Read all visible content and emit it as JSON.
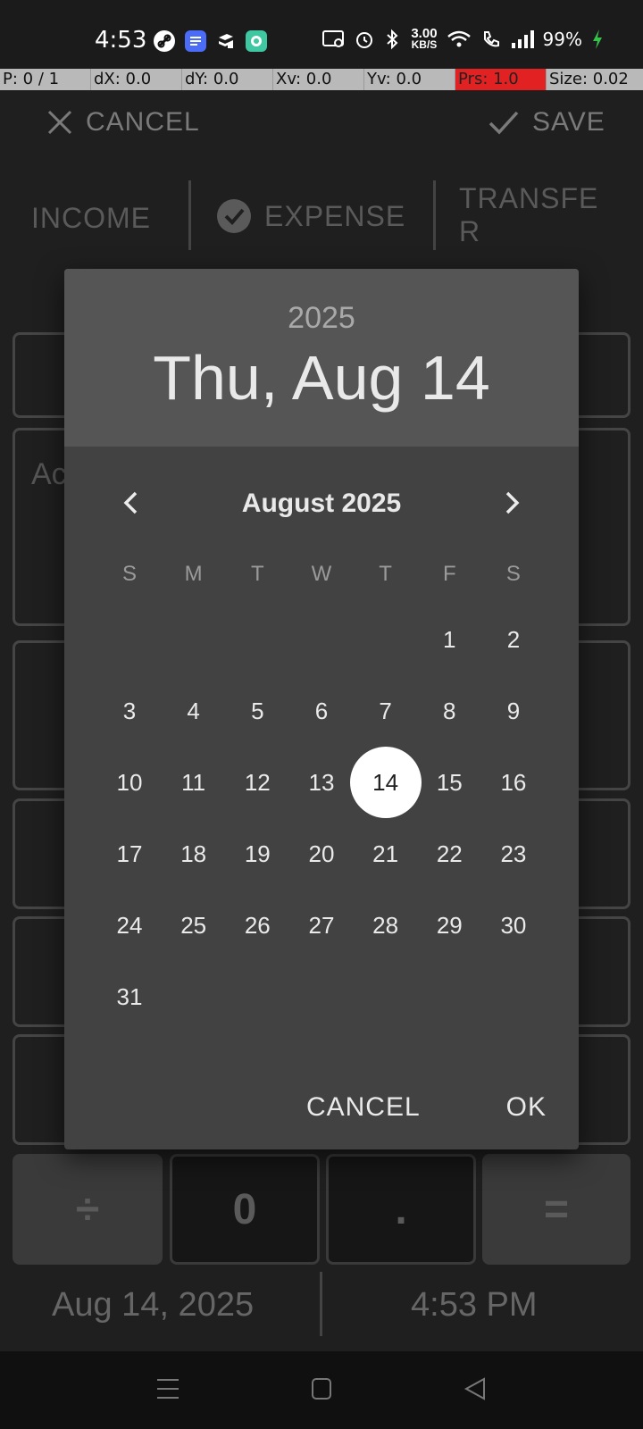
{
  "status_bar": {
    "time": "4:53",
    "net_speed_value": "3.00",
    "net_speed_unit": "KB/S",
    "battery_percent": "99%",
    "app_icons": [
      "link-app-icon",
      "docs-app-icon",
      "layers-app-icon",
      "chat-app-icon"
    ],
    "colors": {
      "battery_charging": "#35c24b",
      "docs_app": "#4a6cf7",
      "chat_app": "#3ec7a0"
    }
  },
  "debug_bar": {
    "cells": [
      "P: 0 / 1",
      "dX: 0.0",
      "dY: 0.0",
      "Xv: 0.0",
      "Yv: 0.0",
      "Prs: 1.0",
      "Size: 0.02"
    ],
    "highlight_color": "#e22222"
  },
  "toolbar": {
    "cancel_label": "CANCEL",
    "save_label": "SAVE"
  },
  "type_tabs": {
    "income": "INCOME",
    "expense": "EXPENSE",
    "transfer_line1": "TRANSFE",
    "transfer_line2": "R",
    "selected": "expense"
  },
  "background": {
    "account_placeholder_partial": "Ac",
    "keypad_bottom": [
      "÷",
      "0",
      ".",
      "="
    ],
    "date": "Aug 14, 2025",
    "time": "4:53 PM"
  },
  "date_picker": {
    "year": "2025",
    "selected_date": "Thu, Aug 14",
    "month_label": "August 2025",
    "weekdays": [
      "S",
      "M",
      "T",
      "W",
      "T",
      "F",
      "S"
    ],
    "weeks": [
      [
        "",
        "",
        "",
        "",
        "",
        "1",
        "2"
      ],
      [
        "3",
        "4",
        "5",
        "6",
        "7",
        "8",
        "9"
      ],
      [
        "10",
        "11",
        "12",
        "13",
        "14",
        "15",
        "16"
      ],
      [
        "17",
        "18",
        "19",
        "20",
        "21",
        "22",
        "23"
      ],
      [
        "24",
        "25",
        "26",
        "27",
        "28",
        "29",
        "30"
      ],
      [
        "31",
        "",
        "",
        "",
        "",
        "",
        ""
      ]
    ],
    "selected_day": "14",
    "cancel_label": "CANCEL",
    "ok_label": "OK",
    "colors": {
      "header_bg": "#555555",
      "body_bg": "#424242",
      "selected_circle": "#ffffff"
    }
  }
}
